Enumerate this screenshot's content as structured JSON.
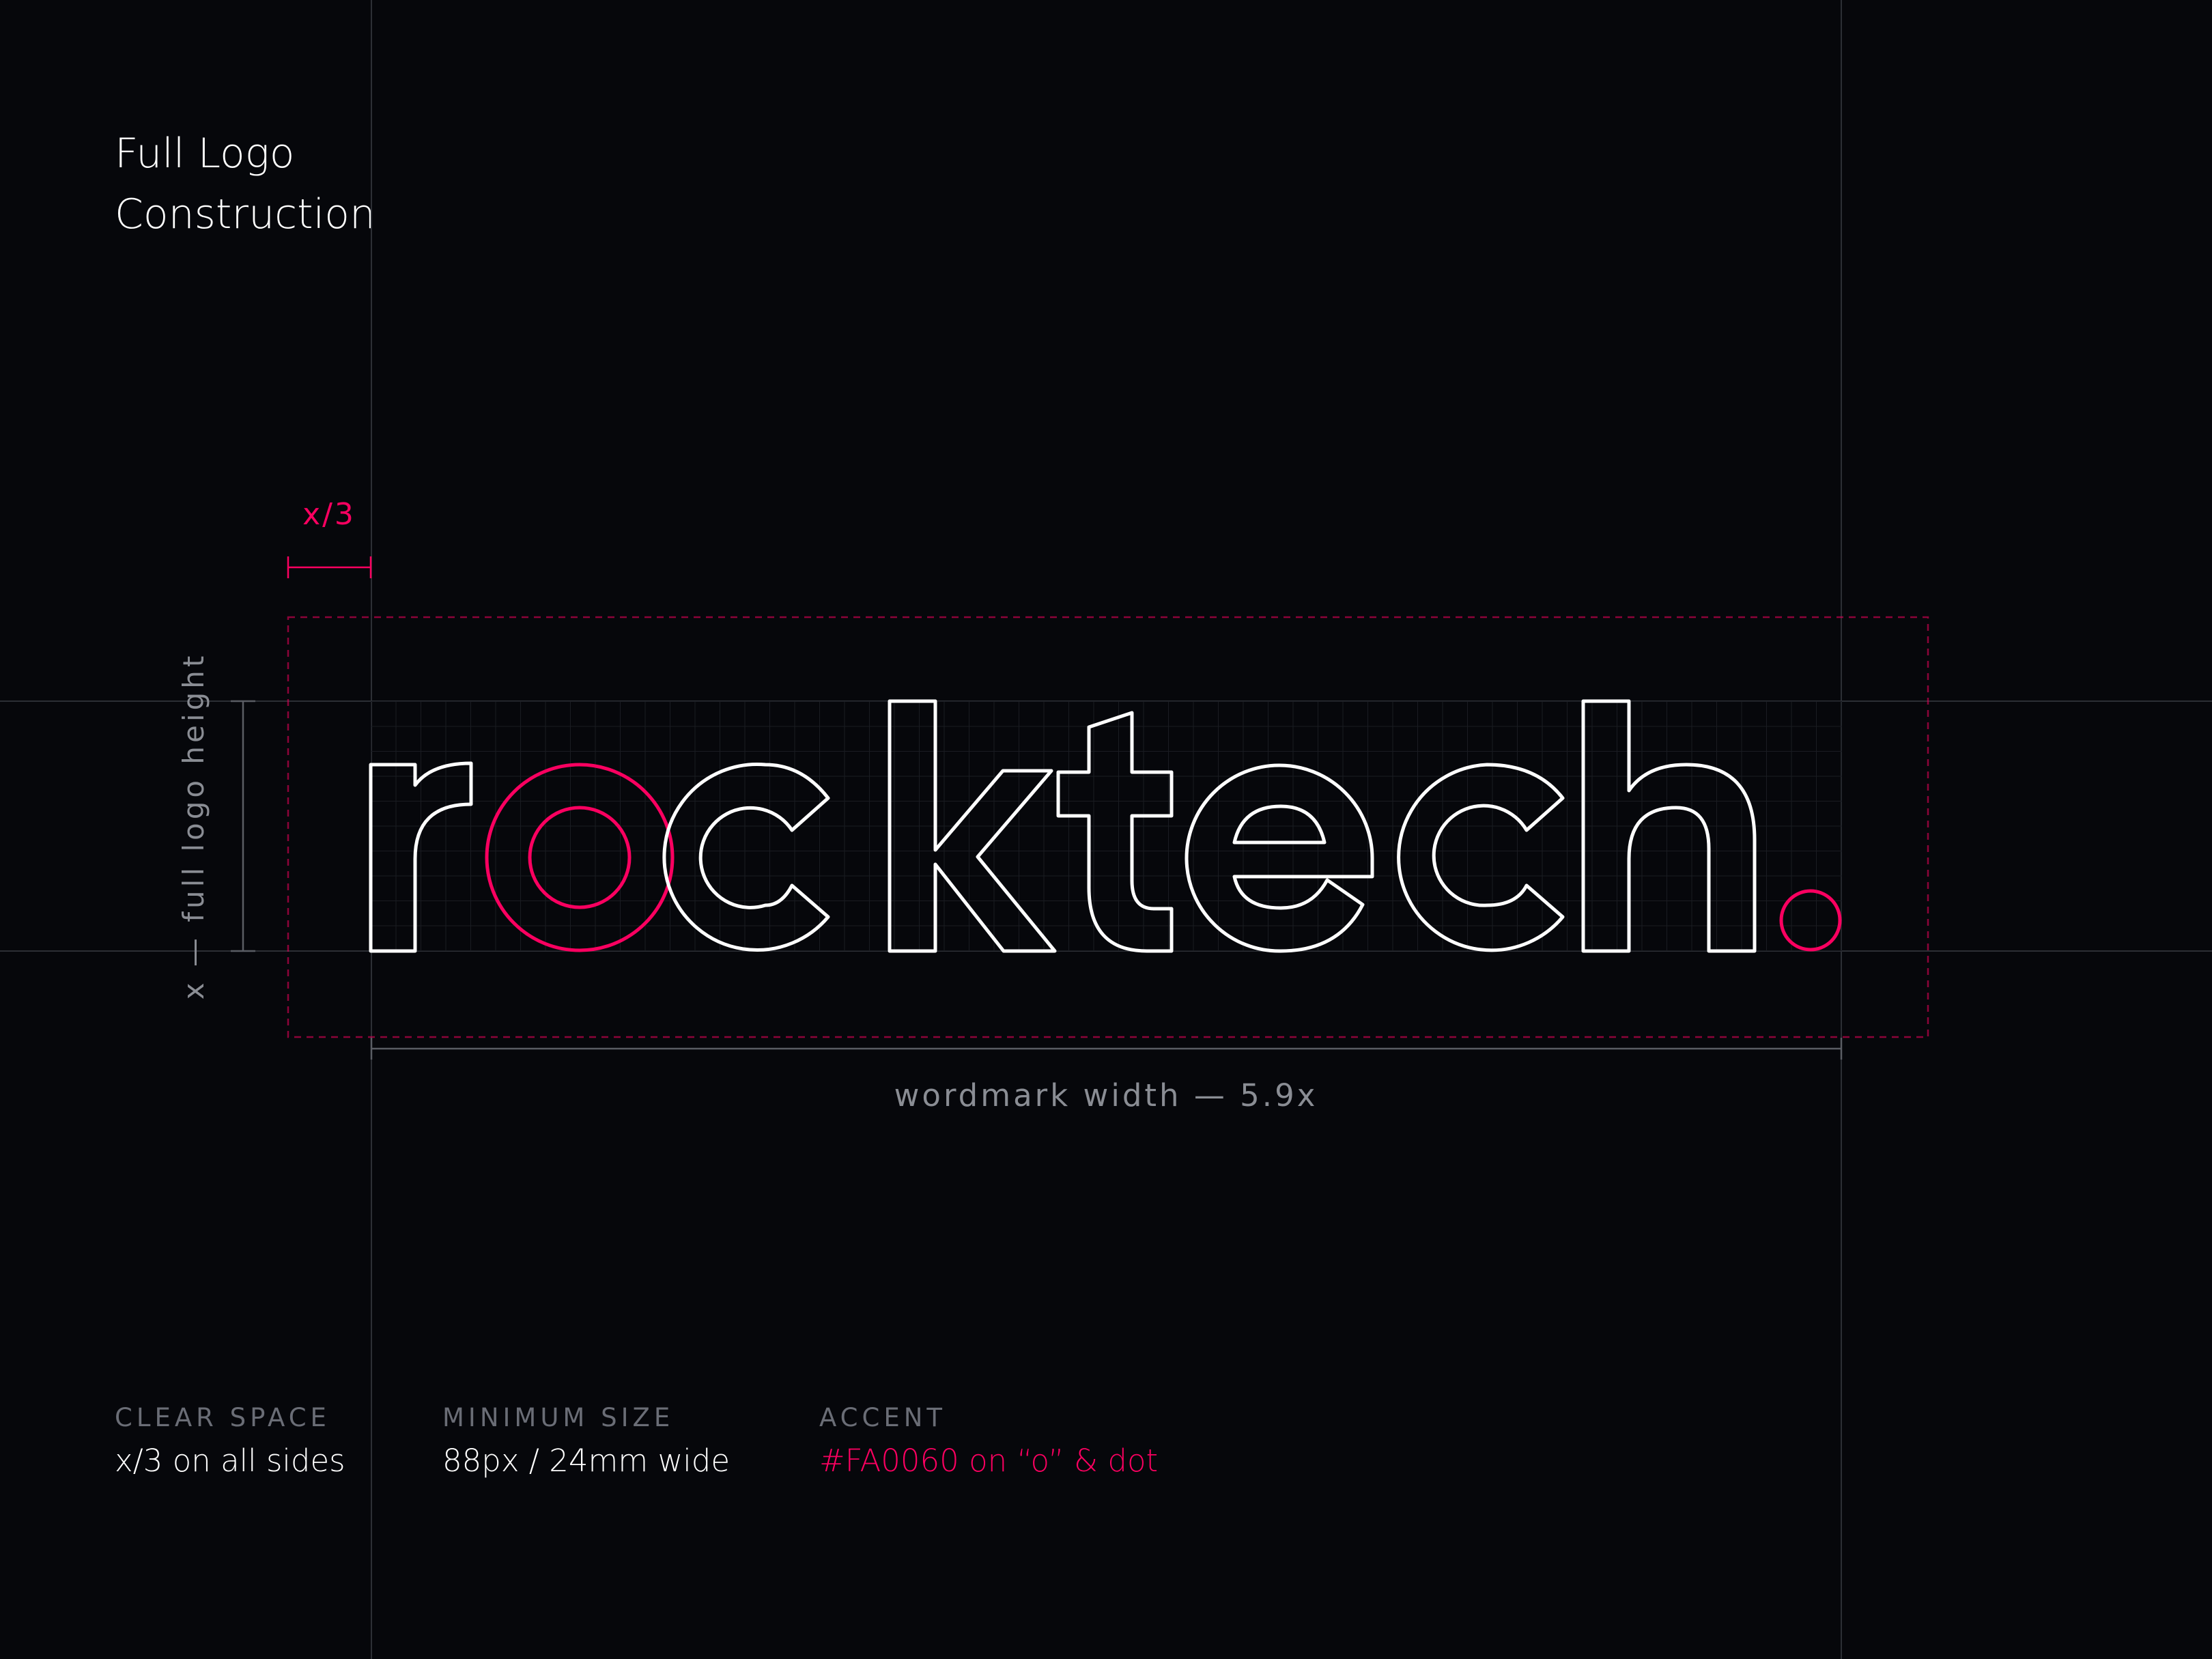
{
  "title": {
    "line1": "Full Logo",
    "line2": "Construction"
  },
  "wordmark": {
    "text": "rocktech.",
    "letters": [
      "r",
      "o",
      "c",
      "k",
      "t",
      "e",
      "c",
      "h",
      "."
    ],
    "accent_letters": [
      "o",
      "."
    ]
  },
  "annotations": {
    "clear_space_label": "x/3",
    "height_label": "x — full logo height",
    "width_label": "wordmark width — 5.9x"
  },
  "specs": [
    {
      "label": "CLEAR SPACE",
      "value": "x/3 on all sides"
    },
    {
      "label": "MINIMUM SIZE",
      "value": "88px / 24mm wide"
    },
    {
      "label": "ACCENT",
      "value": "#FA0060 on “o” & dot"
    }
  ],
  "colors": {
    "background": "#06070b",
    "accent": "#FA0060",
    "outline": "#ffffff",
    "guide": "#3a3d44",
    "muted_text": "#8a8d94"
  }
}
